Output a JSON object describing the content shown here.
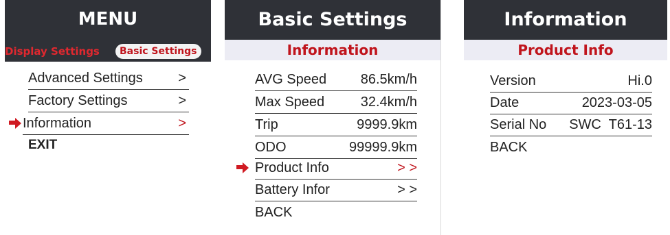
{
  "menu": {
    "title": "MENU",
    "tabs": [
      "Display Settings",
      "Basic Settings"
    ],
    "items": [
      {
        "label": "Advanced Settings",
        "chevron": ">"
      },
      {
        "label": "Factory Settings",
        "chevron": ">"
      },
      {
        "label": "Information",
        "chevron": ">"
      },
      {
        "label": "EXIT"
      }
    ]
  },
  "basic": {
    "title": "Basic Settings",
    "subtitle": "Information",
    "items": [
      {
        "label": "AVG Speed",
        "value": "86.5km/h"
      },
      {
        "label": "Max Speed",
        "value": "32.4km/h"
      },
      {
        "label": "Trip",
        "value": "9999.9km"
      },
      {
        "label": "ODO",
        "value": "99999.9km"
      },
      {
        "label": "Product Info",
        "value": "> >"
      },
      {
        "label": "Battery Infor",
        "value": "> >"
      },
      {
        "label": "BACK"
      }
    ]
  },
  "info": {
    "title": "Information",
    "subtitle": "Product Info",
    "items": [
      {
        "label": "Version",
        "value": "Hi.0"
      },
      {
        "label": "Date",
        "value": "2023-03-05"
      },
      {
        "label": "Serial No",
        "value": "SWC  T61-13"
      },
      {
        "label": "BACK"
      }
    ]
  },
  "colors": {
    "header_bg": "#2f3137",
    "accent": "#c0141c",
    "subbar_bg": "#ececf4"
  },
  "icons": {
    "selection_marker": "right-arrow-icon"
  }
}
